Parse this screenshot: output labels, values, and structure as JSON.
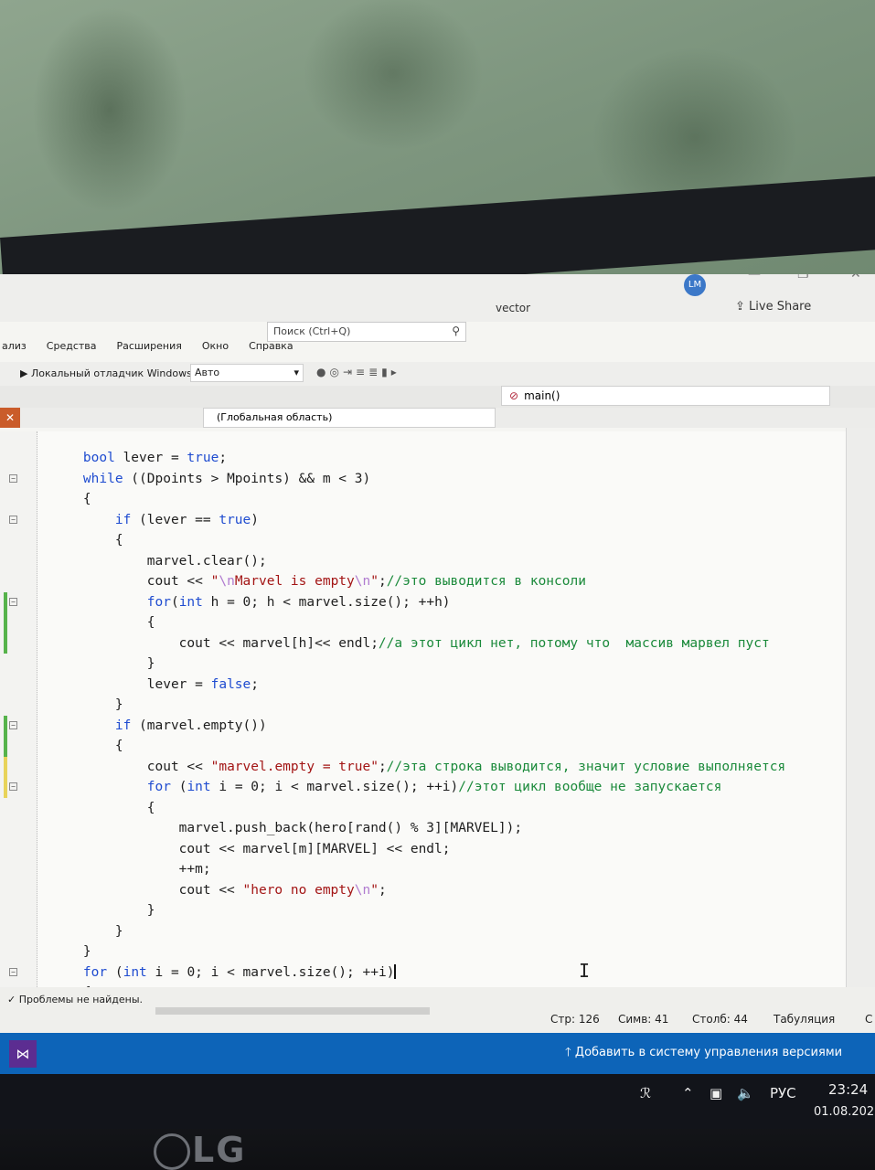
{
  "window": {
    "project_name": "vector",
    "avatar_initials": "LM",
    "live_share": "Live Share",
    "minimize_glyph": "—",
    "restore_glyph": "❐",
    "close_glyph": "✕"
  },
  "menu": [
    {
      "label": "ализ"
    },
    {
      "label": "Средства"
    },
    {
      "label": "Расширения"
    },
    {
      "label": "Окно"
    },
    {
      "label": "Справка"
    }
  ],
  "search": {
    "placeholder": "Поиск (Ctrl+Q)"
  },
  "toolbar": {
    "debugger_label": "Локальный отладчик Windows",
    "config_value": "Авто"
  },
  "navbar": {
    "scope": "(Глобальная область)",
    "member": "main()"
  },
  "doc_tab": {
    "close_glyph": "✕"
  },
  "code_lines": [
    [
      {
        "t": "    "
      },
      {
        "t": "bool",
        "c": "kw"
      },
      {
        "t": " lever = "
      },
      {
        "t": "true",
        "c": "kw"
      },
      {
        "t": ";"
      }
    ],
    [
      {
        "t": "    "
      },
      {
        "t": "while",
        "c": "kw"
      },
      {
        "t": " ((Dpoints > Mpoints) && m < 3)"
      }
    ],
    [
      {
        "t": "    {"
      }
    ],
    [
      {
        "t": "        "
      },
      {
        "t": "if",
        "c": "kw"
      },
      {
        "t": " (lever == "
      },
      {
        "t": "true",
        "c": "kw"
      },
      {
        "t": ")"
      }
    ],
    [
      {
        "t": "        {"
      }
    ],
    [
      {
        "t": "            marvel.clear();"
      }
    ],
    [
      {
        "t": "            cout << "
      },
      {
        "t": "\"",
        "c": "str"
      },
      {
        "t": "\\n",
        "c": "esc"
      },
      {
        "t": "Marvel is empty",
        "c": "str"
      },
      {
        "t": "\\n",
        "c": "esc"
      },
      {
        "t": "\"",
        "c": "str"
      },
      {
        "t": ";"
      },
      {
        "t": "//это выводится в консоли",
        "c": "cmt"
      }
    ],
    [
      {
        "t": "            "
      },
      {
        "t": "for",
        "c": "kw"
      },
      {
        "t": "("
      },
      {
        "t": "int",
        "c": "kw"
      },
      {
        "t": " h = 0; h < marvel.size(); ++h)"
      }
    ],
    [
      {
        "t": "            {"
      }
    ],
    [
      {
        "t": "                cout << marvel[h]<< endl;"
      },
      {
        "t": "//а этот цикл нет, потому что  массив марвел пуст",
        "c": "cmt"
      }
    ],
    [
      {
        "t": "            }"
      }
    ],
    [
      {
        "t": "            lever = "
      },
      {
        "t": "false",
        "c": "kw"
      },
      {
        "t": ";"
      }
    ],
    [
      {
        "t": "        }"
      }
    ],
    [
      {
        "t": "        "
      },
      {
        "t": "if",
        "c": "kw"
      },
      {
        "t": " (marvel.empty())"
      }
    ],
    [
      {
        "t": "        {"
      }
    ],
    [
      {
        "t": "            cout << "
      },
      {
        "t": "\"marvel.empty = true\"",
        "c": "str"
      },
      {
        "t": ";"
      },
      {
        "t": "//эта строка выводится, значит условие выполняется",
        "c": "cmt"
      }
    ],
    [
      {
        "t": "            "
      },
      {
        "t": "for",
        "c": "kw"
      },
      {
        "t": " ("
      },
      {
        "t": "int",
        "c": "kw"
      },
      {
        "t": " i = 0; i < marvel.size(); ++i)"
      },
      {
        "t": "//этот цикл вообще не запускается",
        "c": "cmt"
      }
    ],
    [
      {
        "t": "            {"
      }
    ],
    [
      {
        "t": "                marvel.push_back(hero[rand() % 3][MARVEL]);"
      }
    ],
    [
      {
        "t": "                cout << marvel[m][MARVEL] << endl;"
      }
    ],
    [
      {
        "t": "                ++m;"
      }
    ],
    [
      {
        "t": "                cout << "
      },
      {
        "t": "\"hero no empty",
        "c": "str"
      },
      {
        "t": "\\n",
        "c": "esc"
      },
      {
        "t": "\"",
        "c": "str"
      },
      {
        "t": ";"
      }
    ],
    [
      {
        "t": "            }"
      }
    ],
    [
      {
        "t": "        }"
      }
    ],
    [
      {
        "t": "    }"
      }
    ],
    [
      {
        "t": "    "
      },
      {
        "t": "for",
        "c": "kw"
      },
      {
        "t": " ("
      },
      {
        "t": "int",
        "c": "kw"
      },
      {
        "t": " i = 0; i < marvel.size(); ++i)"
      }
    ],
    [
      {
        "t": "    {"
      }
    ]
  ],
  "status": {
    "problems": "Проблемы не найдены.",
    "line": "Стр: 126",
    "char": "Симв: 41",
    "col": "Столб: 44",
    "indent": "Табуляция",
    "partial": "С"
  },
  "vcs": {
    "label": "Добавить в систему управления версиями"
  },
  "taskbar": {
    "lang": "РУС",
    "time": "23:24",
    "date": "01.08.202"
  },
  "bezel": {
    "brand": "LG"
  },
  "colors": {
    "keyword": "#1f4cd0",
    "string": "#a31515",
    "comment": "#1b8a3b",
    "statusbar": "#0d64b8"
  }
}
